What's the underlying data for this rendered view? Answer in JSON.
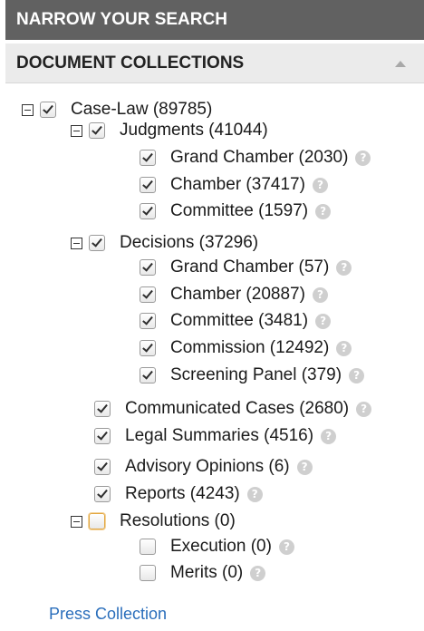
{
  "header": {
    "title": "NARROW YOUR SEARCH"
  },
  "collections": {
    "title": "DOCUMENT COLLECTIONS",
    "collapse_icon": "triangle-up-icon",
    "help_glyph": "?"
  },
  "tree": {
    "case_law": {
      "label": "Case-Law (89785)",
      "checked": true
    },
    "judgments": {
      "label": "Judgments (41044)",
      "checked": true
    },
    "judgments_items": [
      {
        "label": "Grand Chamber (2030)",
        "checked": true
      },
      {
        "label": "Chamber (37417)",
        "checked": true
      },
      {
        "label": "Committee (1597)",
        "checked": true
      }
    ],
    "decisions": {
      "label": "Decisions (37296)",
      "checked": true
    },
    "decisions_items": [
      {
        "label": "Grand Chamber (57)",
        "checked": true
      },
      {
        "label": "Chamber (20887)",
        "checked": true
      },
      {
        "label": "Committee (3481)",
        "checked": true
      },
      {
        "label": "Commission (12492)",
        "checked": true
      },
      {
        "label": "Screening Panel (379)",
        "checked": true
      }
    ],
    "others": [
      {
        "label": "Communicated Cases (2680)",
        "checked": true
      },
      {
        "label": "Legal Summaries (4516)",
        "checked": true
      },
      {
        "label": "Advisory Opinions (6)",
        "checked": true
      },
      {
        "label": "Reports (4243)",
        "checked": true
      }
    ],
    "resolutions": {
      "label": "Resolutions (0)",
      "checked": false
    },
    "resolutions_items": [
      {
        "label": "Execution (0)",
        "checked": false
      },
      {
        "label": "Merits (0)",
        "checked": false
      }
    ]
  },
  "press_link": "Press Collection",
  "colors": {
    "header_bg": "#616161",
    "subheader_bg": "#ebebeb",
    "link": "#2a6ebb",
    "focus": "#e2a640"
  }
}
